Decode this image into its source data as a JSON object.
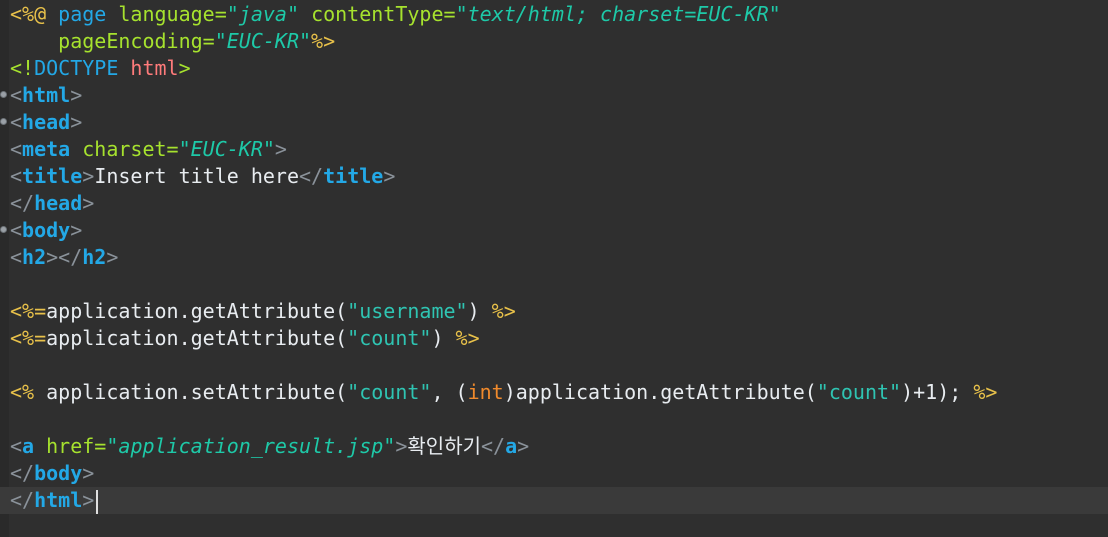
{
  "editor": {
    "lines": [
      {
        "tokens": [
          {
            "t": "<%@ ",
            "c": "jsp"
          },
          {
            "t": "page ",
            "c": "kw"
          },
          {
            "t": "language=",
            "c": "attr"
          },
          {
            "t": "\"java\"",
            "c": "str"
          },
          {
            "t": " ",
            "c": "txt"
          },
          {
            "t": "contentType=",
            "c": "attr"
          },
          {
            "t": "\"text/html; charset=EUC-KR\"",
            "c": "str"
          }
        ]
      },
      {
        "tokens": [
          {
            "t": "    ",
            "c": "txt"
          },
          {
            "t": "pageEncoding=",
            "c": "attr"
          },
          {
            "t": "\"EUC-KR\"",
            "c": "str"
          },
          {
            "t": "%>",
            "c": "jsp"
          }
        ]
      },
      {
        "tokens": [
          {
            "t": "<!",
            "c": "doct"
          },
          {
            "t": "DOCTYPE",
            "c": "kw"
          },
          {
            "t": " html",
            "c": "docv"
          },
          {
            "t": ">",
            "c": "doct"
          }
        ]
      },
      {
        "fold": true,
        "tokens": [
          {
            "t": "<",
            "c": "ang"
          },
          {
            "t": "html",
            "c": "tag"
          },
          {
            "t": ">",
            "c": "ang"
          }
        ]
      },
      {
        "fold": true,
        "tokens": [
          {
            "t": "<",
            "c": "ang"
          },
          {
            "t": "head",
            "c": "tag"
          },
          {
            "t": ">",
            "c": "ang"
          }
        ]
      },
      {
        "tokens": [
          {
            "t": "<",
            "c": "ang"
          },
          {
            "t": "meta",
            "c": "tag"
          },
          {
            "t": " ",
            "c": "txt"
          },
          {
            "t": "charset=",
            "c": "attr"
          },
          {
            "t": "\"EUC-KR\"",
            "c": "str"
          },
          {
            "t": ">",
            "c": "ang"
          }
        ]
      },
      {
        "tokens": [
          {
            "t": "<",
            "c": "ang"
          },
          {
            "t": "title",
            "c": "tag"
          },
          {
            "t": ">",
            "c": "ang"
          },
          {
            "t": "Insert title here",
            "c": "txt"
          },
          {
            "t": "</",
            "c": "ang"
          },
          {
            "t": "title",
            "c": "tag"
          },
          {
            "t": ">",
            "c": "ang"
          }
        ]
      },
      {
        "tokens": [
          {
            "t": "</",
            "c": "ang"
          },
          {
            "t": "head",
            "c": "tag"
          },
          {
            "t": ">",
            "c": "ang"
          }
        ]
      },
      {
        "fold": true,
        "tokens": [
          {
            "t": "<",
            "c": "ang"
          },
          {
            "t": "body",
            "c": "tag"
          },
          {
            "t": ">",
            "c": "ang"
          }
        ]
      },
      {
        "tokens": [
          {
            "t": "<",
            "c": "ang"
          },
          {
            "t": "h2",
            "c": "tag"
          },
          {
            "t": "></",
            "c": "ang"
          },
          {
            "t": "h2",
            "c": "tag"
          },
          {
            "t": ">",
            "c": "ang"
          }
        ]
      },
      {
        "tokens": []
      },
      {
        "tokens": [
          {
            "t": "<%=",
            "c": "jsp"
          },
          {
            "t": "application.getAttribute(",
            "c": "txt"
          },
          {
            "t": "\"username\"",
            "c": "plainstr"
          },
          {
            "t": ") ",
            "c": "txt"
          },
          {
            "t": "%>",
            "c": "jsp"
          }
        ]
      },
      {
        "tokens": [
          {
            "t": "<%=",
            "c": "jsp"
          },
          {
            "t": "application.getAttribute(",
            "c": "txt"
          },
          {
            "t": "\"count\"",
            "c": "plainstr"
          },
          {
            "t": ") ",
            "c": "txt"
          },
          {
            "t": "%>",
            "c": "jsp"
          }
        ]
      },
      {
        "tokens": []
      },
      {
        "tokens": [
          {
            "t": "<%",
            "c": "jsp"
          },
          {
            "t": " application.setAttribute(",
            "c": "txt"
          },
          {
            "t": "\"count\"",
            "c": "plainstr"
          },
          {
            "t": ", (",
            "c": "txt"
          },
          {
            "t": "int",
            "c": "type"
          },
          {
            "t": ")application.getAttribute(",
            "c": "txt"
          },
          {
            "t": "\"count\"",
            "c": "plainstr"
          },
          {
            "t": ")+1); ",
            "c": "txt"
          },
          {
            "t": "%>",
            "c": "jsp"
          }
        ]
      },
      {
        "tokens": []
      },
      {
        "tokens": [
          {
            "t": "<",
            "c": "ang"
          },
          {
            "t": "a",
            "c": "tag"
          },
          {
            "t": " ",
            "c": "txt"
          },
          {
            "t": "href=",
            "c": "attr"
          },
          {
            "t": "\"application_result.jsp\"",
            "c": "str"
          },
          {
            "t": ">",
            "c": "ang"
          },
          {
            "t": "확인하기",
            "c": "txt kor"
          },
          {
            "t": "</",
            "c": "ang"
          },
          {
            "t": "a",
            "c": "tag"
          },
          {
            "t": ">",
            "c": "ang"
          }
        ]
      },
      {
        "tokens": [
          {
            "t": "</",
            "c": "ang"
          },
          {
            "t": "body",
            "c": "tag"
          },
          {
            "t": ">",
            "c": "ang"
          }
        ]
      },
      {
        "current": true,
        "tokens": [
          {
            "t": "</",
            "c": "ang"
          },
          {
            "t": "html",
            "c": "tag"
          },
          {
            "t": ">",
            "c": "ang"
          }
        ]
      }
    ]
  }
}
